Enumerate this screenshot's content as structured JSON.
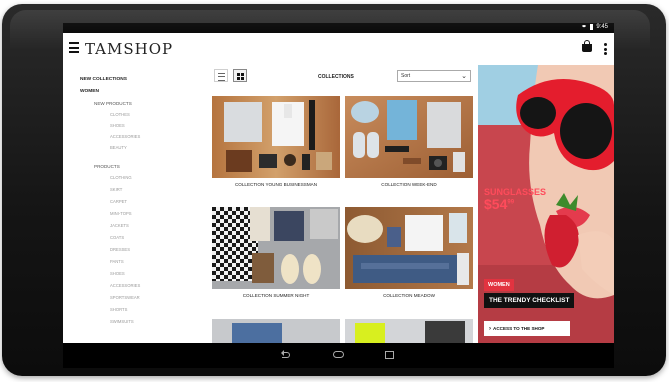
{
  "status_bar": {
    "time": "9:45"
  },
  "app": {
    "logo": "TAMSHOP",
    "menu_icon": "hamburger-menu-icon",
    "cart_icon": "shopping-bag-icon",
    "more_icon": "more-vertical-icon"
  },
  "sidebar": {
    "new_collections": "New Collections",
    "women": "Women",
    "new_products": "New Products",
    "new_products_items": [
      "Clothes",
      "Shoes",
      "Accessories",
      "Beauty"
    ],
    "products": "Products",
    "products_items": [
      "Clothing",
      "Skirt",
      "Carpet",
      "Mini-Tops",
      "Jackets",
      "Coats",
      "Dresses",
      "Pants",
      "Shoes",
      "Accessories",
      "Sportswear",
      "Shorts",
      "Swimsuits"
    ]
  },
  "main": {
    "list_view_icon": "list-view-icon",
    "grid_view_icon": "grid-view-icon",
    "title": "Collections",
    "sort_value": "Sort",
    "cards": [
      {
        "caption": "Collection Young Businessman"
      },
      {
        "caption": "Collection Week-End"
      },
      {
        "caption": "Collection Summer Night"
      },
      {
        "caption": "Collection Meadow"
      }
    ]
  },
  "ad": {
    "headline": "Sunglasses",
    "price": "$54",
    "price_cents": "99",
    "tag_women": "Women",
    "tagline": "The Trendy Checklist",
    "button": "Access to the shop"
  },
  "colors": {
    "ad_red": "#e23340",
    "ad_pink_text": "#ff4b5b",
    "tablet_bezel": "#151515"
  }
}
